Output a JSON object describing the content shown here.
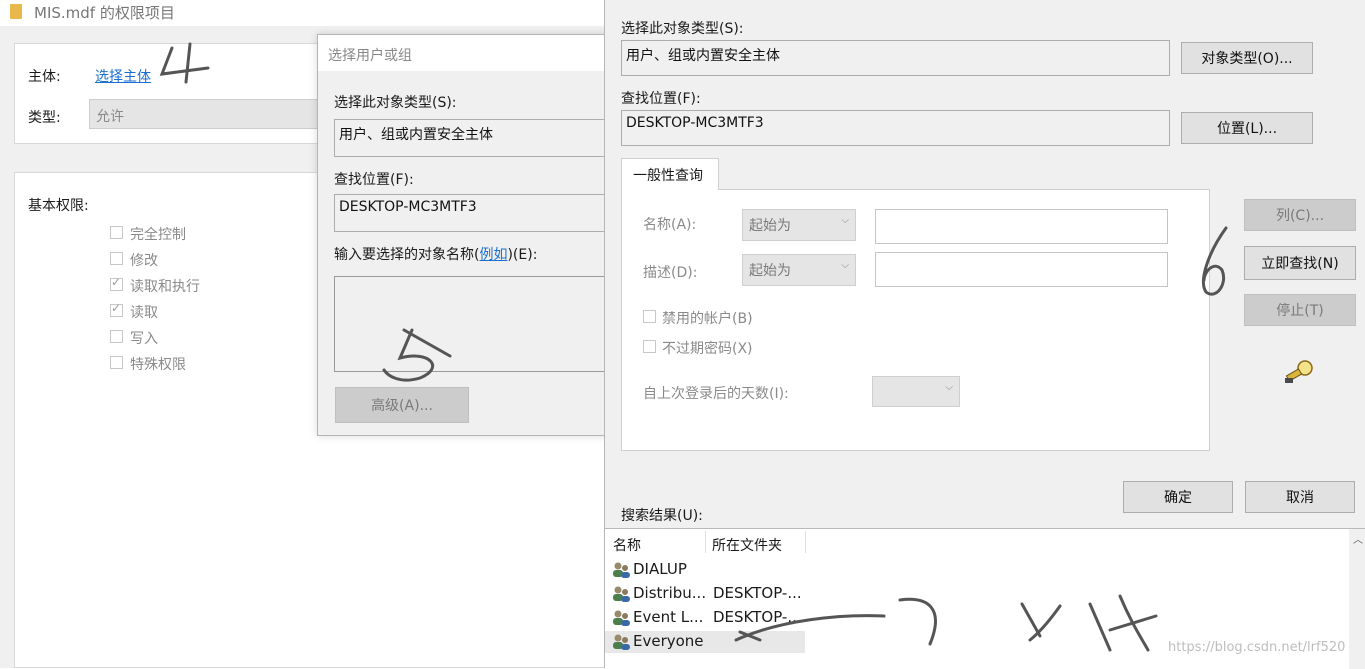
{
  "permission_window": {
    "title": "MIS.mdf 的权限项目",
    "principal_label": "主体:",
    "principal_link": "选择主体",
    "type_label": "类型:",
    "type_value": "允许",
    "basic_perms_label": "基本权限:",
    "perms": [
      {
        "label": "完全控制",
        "checked": false
      },
      {
        "label": "修改",
        "checked": false
      },
      {
        "label": "读取和执行",
        "checked": true
      },
      {
        "label": "读取",
        "checked": true
      },
      {
        "label": "写入",
        "checked": false
      },
      {
        "label": "特殊权限",
        "checked": false
      }
    ]
  },
  "select_dialog": {
    "title": "选择用户或组",
    "object_type_label": "选择此对象类型(S):",
    "object_type_value": "用户、组或内置安全主体",
    "location_label": "查找位置(F):",
    "location_value": "DESKTOP-MC3MTF3",
    "enter_label_prefix": "输入要选择的对象名称(",
    "enter_label_link": "例如",
    "enter_label_suffix": ")(E):",
    "advanced_button": "高级(A)..."
  },
  "advanced_dialog": {
    "object_type_label": "选择此对象类型(S):",
    "object_type_value": "用户、组或内置安全主体",
    "object_type_button": "对象类型(O)...",
    "location_label": "查找位置(F):",
    "location_value": "DESKTOP-MC3MTF3",
    "location_button": "位置(L)...",
    "tab_label": "一般性查询",
    "name_label": "名称(A):",
    "name_combo": "起始为",
    "desc_label": "描述(D):",
    "desc_combo": "起始为",
    "disabled_accounts": "禁用的帐户(B)",
    "non_expiring": "不过期密码(X)",
    "days_since_login": "自上次登录后的天数(I):",
    "columns_button": "列(C)...",
    "find_now_button": "立即查找(N)",
    "stop_button": "停止(T)",
    "ok_button": "确定",
    "cancel_button": "取消",
    "results_label": "搜索结果(U):",
    "results_headers": [
      "名称",
      "所在文件夹"
    ],
    "results_rows": [
      {
        "name": "DIALUP",
        "folder": ""
      },
      {
        "name": "Distribu...",
        "folder": "DESKTOP-..."
      },
      {
        "name": "Event L...",
        "folder": "DESKTOP-..."
      },
      {
        "name": "Everyone",
        "folder": ""
      }
    ]
  },
  "watermark": "https://blog.csdn.net/lrf520"
}
